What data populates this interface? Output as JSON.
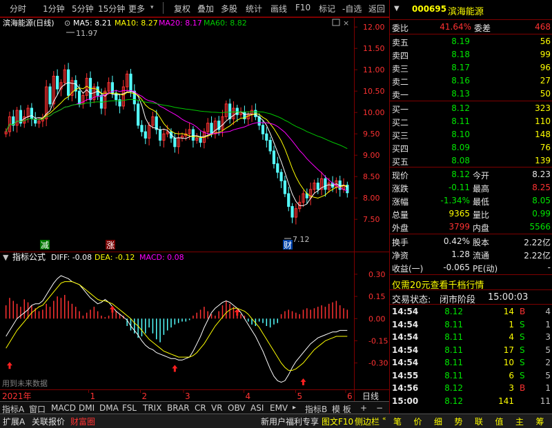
{
  "toolbar": {
    "items": [
      "分时",
      "1分钟",
      "5分钟",
      "15分钟",
      "更多",
      "复权",
      "叠加",
      "多股",
      "统计",
      "画线",
      "F10",
      "标记",
      "-自选",
      "返回"
    ]
  },
  "main_chart": {
    "title": "滨海能源(日线)",
    "ma5": "MA5: 8.21",
    "ma10": "MA10: 8.27",
    "ma20": "MA20: 8.17",
    "ma60": "MA60: 8.82",
    "high_label": "11.97",
    "low_label": "7.12",
    "price_ticks": [
      "12.00",
      "11.50",
      "11.00",
      "10.50",
      "10.00",
      "9.50",
      "9.00",
      "8.50",
      "8.00",
      "7.50"
    ],
    "markers": [
      "减",
      "涨",
      "财"
    ]
  },
  "indicator": {
    "title": "指标公式",
    "diff": "DIFF: -0.08",
    "dea": "DEA: -0.12",
    "macd": "MACD: 0.08",
    "ticks": [
      "0.30",
      "0.15",
      "0.00",
      "-0.15",
      "-0.30"
    ],
    "note": "用到未来数据"
  },
  "time_axis": {
    "year": "2021年",
    "months": [
      "1",
      "2",
      "3",
      "4",
      "5",
      "6"
    ],
    "period": "日线"
  },
  "tabs": [
    "指标A",
    "窗口",
    "MACD",
    "DMI",
    "DMA",
    "FSL",
    "TRIX",
    "BRAR",
    "CR",
    "VR",
    "OBV",
    "ASI",
    "EMV",
    "指标B",
    "模 板",
    "+",
    "−"
  ],
  "status_bar": {
    "left": [
      "扩展A",
      "关联报价",
      "财富圈"
    ],
    "promo": "新用户福利专享",
    "right": [
      "图文F10",
      "侧边栏"
    ],
    "keys": [
      "笔",
      "价",
      "细",
      "势",
      "联",
      "值",
      "主",
      "筹"
    ]
  },
  "panel": {
    "code": "000695",
    "name": "滨海能源",
    "weibi_label": "委比",
    "weibi": "41.64%",
    "weicha_label": "委差",
    "weicha": "468",
    "asks": [
      {
        "label": "卖五",
        "price": "8.19",
        "vol": "56"
      },
      {
        "label": "卖四",
        "price": "8.18",
        "vol": "99"
      },
      {
        "label": "卖三",
        "price": "8.17",
        "vol": "96"
      },
      {
        "label": "卖二",
        "price": "8.16",
        "vol": "27"
      },
      {
        "label": "卖一",
        "price": "8.13",
        "vol": "50"
      }
    ],
    "bids": [
      {
        "label": "买一",
        "price": "8.12",
        "vol": "323"
      },
      {
        "label": "买二",
        "price": "8.11",
        "vol": "110"
      },
      {
        "label": "买三",
        "price": "8.10",
        "vol": "148"
      },
      {
        "label": "买四",
        "price": "8.09",
        "vol": "76"
      },
      {
        "label": "买五",
        "price": "8.08",
        "vol": "139"
      }
    ],
    "quote": [
      {
        "l1": "现价",
        "v1": "8.12",
        "l2": "今开",
        "v2": "8.23"
      },
      {
        "l1": "涨跌",
        "v1": "-0.11",
        "l2": "最高",
        "v2": "8.25"
      },
      {
        "l1": "涨幅",
        "v1": "-1.34%",
        "l2": "最低",
        "v2": "8.05"
      },
      {
        "l1": "总量",
        "v1": "9365",
        "l2": "量比",
        "v2": "0.99"
      },
      {
        "l1": "外盘",
        "v1": "3799",
        "l2": "内盘",
        "v2": "5566"
      }
    ],
    "fund": [
      {
        "l1": "换手",
        "v1": "0.42%",
        "l2": "股本",
        "v2": "2.22亿"
      },
      {
        "l1": "净资",
        "v1": "1.28",
        "l2": "流通",
        "v2": "2.22亿"
      },
      {
        "l1": "收益(一)",
        "v1": "-0.065",
        "l2": "PE(动)",
        "v2": "-"
      }
    ],
    "promo": "仅需20元查看千档行情",
    "trade_status_label": "交易状态:",
    "trade_status": "闭市阶段",
    "trade_time": "15:00:03",
    "ticks": [
      {
        "time": "14:54",
        "price": "8.12",
        "vol": "14",
        "side": "B",
        "num": "4"
      },
      {
        "time": "14:54",
        "price": "8.11",
        "vol": "1",
        "side": "S",
        "num": "1"
      },
      {
        "time": "14:54",
        "price": "8.11",
        "vol": "4",
        "side": "S",
        "num": "3"
      },
      {
        "time": "14:54",
        "price": "8.11",
        "vol": "17",
        "side": "S",
        "num": "5"
      },
      {
        "time": "14:54",
        "price": "8.11",
        "vol": "10",
        "side": "S",
        "num": "2"
      },
      {
        "time": "14:55",
        "price": "8.11",
        "vol": "6",
        "side": "S",
        "num": "5"
      },
      {
        "time": "14:56",
        "price": "8.12",
        "vol": "3",
        "side": "B",
        "num": "1"
      },
      {
        "time": "15:00",
        "price": "8.12",
        "vol": "141",
        "side": "",
        "num": "11"
      }
    ]
  },
  "colors": {
    "up": "#ff3232",
    "down": "#54ffff",
    "ma5": "#ffffff",
    "ma10": "#ffff00",
    "ma20": "#ff00ff",
    "ma60": "#00c800",
    "border": "#800000"
  },
  "chart_data": {
    "type": "candlestick",
    "ylim": [
      7.1,
      12.1
    ],
    "close": [
      9.55,
      9.9,
      9.7,
      10.05,
      9.75,
      9.9,
      10.1,
      9.85,
      9.75,
      9.8,
      9.85,
      10.6,
      10.2,
      10.85,
      10.55,
      10.7,
      11.0,
      10.4,
      10.75,
      10.5,
      10.2,
      10.4,
      10.8,
      10.3,
      10.6,
      10.4,
      10.1,
      10.5,
      10.7,
      10.45,
      10.3,
      10.15,
      10.6,
      10.9,
      10.5,
      10.2,
      9.7,
      9.55,
      9.4,
      9.7,
      9.9,
      9.6,
      9.35,
      9.5,
      9.55,
      9.4,
      9.2,
      9.4,
      9.45,
      9.5,
      9.6,
      9.35,
      9.4,
      9.3,
      9.55,
      9.75,
      9.5,
      9.8,
      9.6,
      9.9,
      10.2,
      9.85,
      10.1,
      9.95,
      10.0,
      9.85,
      9.95,
      10.05,
      9.9,
      9.7,
      9.5,
      9.35,
      9.1,
      8.8,
      8.6,
      8.4,
      8.1,
      7.8,
      7.55,
      7.75,
      7.9,
      8.1,
      8.0,
      8.2,
      8.35,
      8.2,
      8.45,
      8.2,
      8.35,
      8.25,
      8.4,
      8.2,
      8.3,
      8.12
    ],
    "macd_hist": [
      0.09,
      0.14,
      0.12,
      0.1,
      0.08,
      0.13,
      0.11,
      0.09,
      0.07,
      0.05,
      0.06,
      0.1,
      0.08,
      0.12,
      0.15,
      0.14,
      0.16,
      0.12,
      0.1,
      0.08,
      0.05,
      0.02,
      0.04,
      0.06,
      0.08,
      0.05,
      0.02,
      0.01,
      0.02,
      0.04,
      0.05,
      0.03,
      0.02,
      -0.05,
      -0.08,
      -0.1,
      -0.13,
      -0.12,
      -0.1,
      -0.06,
      -0.1,
      -0.14,
      -0.16,
      -0.11,
      -0.08,
      -0.06,
      -0.04,
      -0.03,
      -0.02,
      -0.02,
      -0.01,
      0.02,
      0.04,
      0.06,
      0.08,
      0.05,
      0.03,
      0.02,
      0.05,
      0.09,
      0.12,
      0.1,
      0.08,
      0.05,
      0.03,
      0.02,
      -0.02,
      -0.04,
      -0.05,
      -0.02,
      -0.03,
      -0.05,
      -0.06,
      -0.04,
      -0.03,
      0.03,
      0.05,
      0.06,
      0.05,
      0.04,
      0.03,
      0.06,
      0.07,
      0.06,
      0.07,
      0.08,
      0.09,
      0.08,
      0.1,
      0.11,
      0.12,
      0.09,
      0.07,
      0.06
    ],
    "diff": [
      -0.12,
      -0.08,
      -0.04,
      0.0,
      0.02,
      0.04,
      0.06,
      0.09,
      0.1,
      0.1,
      0.12,
      0.16,
      0.2,
      0.24,
      0.27,
      0.29,
      0.28,
      0.27,
      0.25,
      0.24,
      0.23,
      0.2,
      0.17,
      0.14,
      0.12,
      0.1,
      0.11,
      0.13,
      0.11,
      0.08,
      0.05,
      0.03,
      0.01,
      -0.01,
      -0.05,
      -0.08,
      -0.11,
      -0.15,
      -0.18,
      -0.2,
      -0.21,
      -0.23,
      -0.24,
      -0.25,
      -0.26,
      -0.27,
      -0.27,
      -0.28,
      -0.28,
      -0.27,
      -0.26,
      -0.22,
      -0.17,
      -0.12,
      -0.06,
      -0.01,
      0.04,
      0.07,
      0.09,
      0.11,
      0.12,
      0.11,
      0.09,
      0.07,
      0.04,
      0.0,
      -0.04,
      -0.08,
      -0.12,
      -0.17,
      -0.22,
      -0.28,
      -0.34,
      -0.39,
      -0.42,
      -0.43,
      -0.42,
      -0.38,
      -0.33,
      -0.29,
      -0.26,
      -0.23,
      -0.2,
      -0.17,
      -0.15,
      -0.13,
      -0.12,
      -0.11,
      -0.1,
      -0.09,
      -0.09,
      -0.08,
      -0.08,
      -0.08
    ],
    "dea": [
      -0.2,
      -0.16,
      -0.12,
      -0.08,
      -0.05,
      -0.02,
      0.01,
      0.04,
      0.06,
      0.08,
      0.09,
      0.12,
      0.15,
      0.18,
      0.21,
      0.24,
      0.25,
      0.25,
      0.25,
      0.24,
      0.23,
      0.21,
      0.19,
      0.17,
      0.15,
      0.13,
      0.12,
      0.12,
      0.11,
      0.1,
      0.08,
      0.06,
      0.04,
      0.02,
      0.0,
      -0.03,
      -0.05,
      -0.08,
      -0.11,
      -0.14,
      -0.16,
      -0.18,
      -0.2,
      -0.22,
      -0.23,
      -0.24,
      -0.25,
      -0.26,
      -0.26,
      -0.26,
      -0.26,
      -0.25,
      -0.23,
      -0.2,
      -0.17,
      -0.13,
      -0.09,
      -0.05,
      -0.02,
      0.01,
      0.04,
      0.06,
      0.07,
      0.07,
      0.06,
      0.05,
      0.03,
      0.0,
      -0.03,
      -0.06,
      -0.1,
      -0.14,
      -0.18,
      -0.22,
      -0.26,
      -0.3,
      -0.33,
      -0.35,
      -0.35,
      -0.34,
      -0.32,
      -0.3,
      -0.27,
      -0.24,
      -0.21,
      -0.19,
      -0.17,
      -0.15,
      -0.14,
      -0.13,
      -0.12,
      -0.12,
      -0.12,
      -0.12
    ]
  }
}
